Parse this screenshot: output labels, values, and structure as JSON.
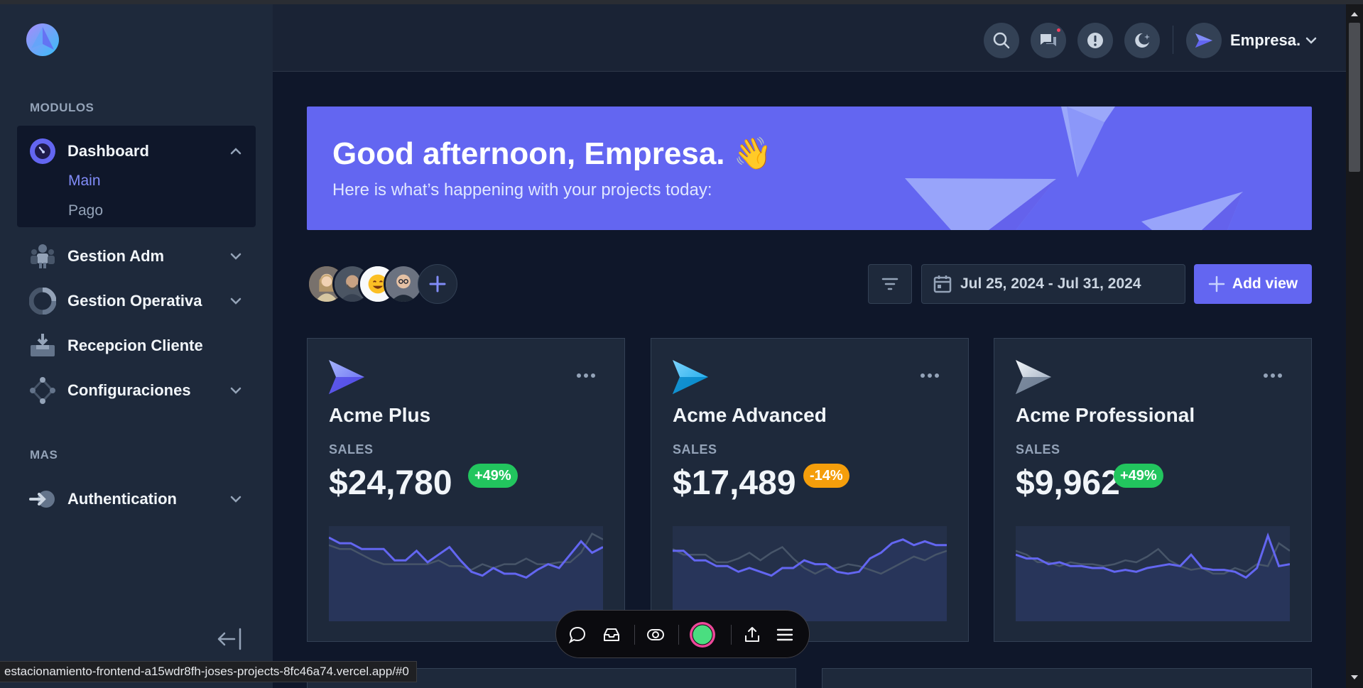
{
  "sidebar": {
    "section_modules": "MODULOS",
    "section_more": "MAS",
    "items": [
      {
        "label": "Dashboard",
        "icon": "dashboard-gauge-icon"
      },
      {
        "label": "Gestion Adm",
        "icon": "people-icon"
      },
      {
        "label": "Gestion Operativa",
        "icon": "pie-chart-icon"
      },
      {
        "label": "Recepcion Cliente",
        "icon": "inbox-download-icon"
      },
      {
        "label": "Configuraciones",
        "icon": "network-nodes-icon"
      },
      {
        "label": "Authentication",
        "icon": "sign-in-icon"
      }
    ],
    "dashboard_sub": [
      {
        "label": "Main",
        "active": true
      },
      {
        "label": "Pago",
        "active": false
      }
    ]
  },
  "header": {
    "user_name": "Empresa.",
    "icons": [
      "search-icon",
      "chat-icon",
      "info-icon",
      "dark-mode-icon"
    ]
  },
  "banner": {
    "greeting": "Good afternoon, Empresa. 👋",
    "subtitle": "Here is what’s happening with your projects today:"
  },
  "actions": {
    "date_range": "Jul 25, 2024 - Jul 31, 2024",
    "add_view_label": "Add view"
  },
  "cards": [
    {
      "title": "Acme Plus",
      "label": "SALES",
      "value": "$24,780",
      "change": "+49%",
      "change_color": "#22c55e",
      "icon_color": "#818cf8",
      "primary_series": [
        88,
        82,
        82,
        76,
        76,
        76,
        64,
        64,
        74,
        62,
        70,
        78,
        64,
        52,
        48,
        56,
        50,
        50,
        46,
        54,
        60,
        56,
        70,
        84,
        72,
        78
      ],
      "secondary_series": [
        80,
        76,
        76,
        70,
        64,
        60,
        60,
        60,
        60,
        60,
        64,
        58,
        58,
        54,
        60,
        56,
        60,
        60,
        66,
        60,
        60,
        62,
        62,
        72,
        92,
        86
      ]
    },
    {
      "title": "Acme Advanced",
      "label": "SALES",
      "value": "$17,489",
      "change": "-14%",
      "change_color": "#f59e0b",
      "icon_color": "#38bdf8",
      "primary_series": [
        74,
        74,
        64,
        64,
        58,
        58,
        52,
        56,
        52,
        48,
        56,
        56,
        64,
        60,
        60,
        52,
        50,
        52,
        66,
        72,
        82,
        86,
        80,
        84,
        80,
        80
      ],
      "secondary_series": [
        76,
        70,
        70,
        70,
        62,
        62,
        66,
        72,
        64,
        72,
        78,
        66,
        56,
        50,
        56,
        56,
        60,
        58,
        54,
        50,
        56,
        62,
        68,
        64,
        70,
        74
      ]
    },
    {
      "title": "Acme Professional",
      "label": "SALES",
      "value": "$9,962",
      "change": "+49%",
      "change_color": "#22c55e",
      "icon_color": "#cbd5e1",
      "primary_series": [
        70,
        66,
        66,
        60,
        62,
        58,
        58,
        56,
        56,
        52,
        54,
        52,
        56,
        58,
        60,
        58,
        70,
        56,
        54,
        54,
        52,
        46,
        56,
        90,
        58,
        60
      ],
      "secondary_series": [
        74,
        70,
        62,
        62,
        58,
        62,
        60,
        60,
        58,
        60,
        64,
        62,
        68,
        76,
        64,
        58,
        54,
        56,
        50,
        50,
        56,
        52,
        60,
        58,
        82,
        74
      ]
    }
  ],
  "status_url": "estacionamiento-frontend-a15wdr8fh-joses-projects-8fc46a74.vercel.app/#0",
  "colors": {
    "accent": "#6366f1",
    "accent_light": "#818cf8",
    "sidebar_bg": "#1e293b",
    "page_bg": "#0f172a"
  }
}
